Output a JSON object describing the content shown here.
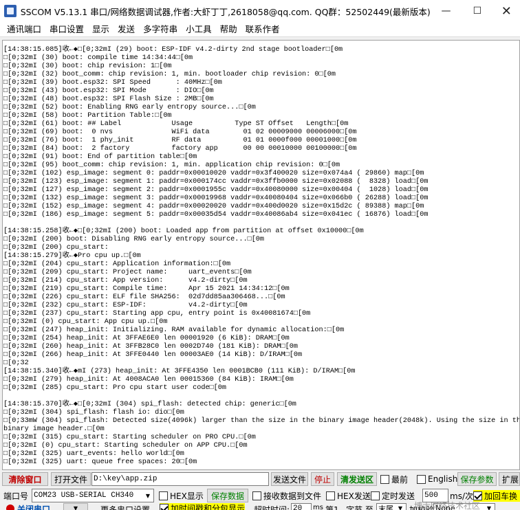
{
  "window": {
    "title": "SSCOM V5.13.1 串口/网络数据调试器,作者:大虾丁丁,2618058@qq.com. QQ群：52502449(最新版本)",
    "minimize": "—",
    "maximize": "☐",
    "close": "✕"
  },
  "menu": [
    "通讯端口",
    "串口设置",
    "显示",
    "发送",
    "多字符串",
    "小工具",
    "帮助",
    "联系作者"
  ],
  "console": {
    "lines": [
      "[14:38:15.085]收←◆□[0;32mI (29) boot: ESP-IDF v4.2-dirty 2nd stage bootloader□[0m",
      "□[0;32mI (30) boot: compile time 14:34:44□[0m",
      "□[0;32mI (30) boot: chip revision: 1□[0m",
      "□[0;32mI (32) boot_comm: chip revision: 1, min. bootloader chip revision: 0□[0m",
      "□[0;32mI (39) boot.esp32: SPI Speed      : 40MHz□[0m",
      "□[0;32mI (43) boot.esp32: SPI Mode       : DIO□[0m",
      "□[0;32mI (48) boot.esp32: SPI Flash Size : 2MB□[0m",
      "□[0;32mI (52) boot: Enabling RNG early entropy source...□[0m",
      "□[0;32mI (58) boot: Partition Table:□[0m",
      "□[0;32mI (61) boot: ## Label            Usage          Type ST Offset   Length□[0m",
      "□[0;32mI (69) boot:  0 nvs              WiFi data        01 02 00009000 00006000□[0m",
      "□[0;32mI (76) boot:  1 phy_init         RF data          01 01 0000f000 00001000□[0m",
      "□[0;32mI (84) boot:  2 factory          factory app      00 00 00010000 00100000□[0m",
      "□[0;32mI (91) boot: End of partition table□[0m",
      "□[0;32mI (95) boot_comm: chip revision: 1, min. application chip revision: 0□[0m",
      "□[0;32mI (102) esp_image: segment 0: paddr=0x00010020 vaddr=0x3f400020 size=0x074a4 ( 29860) map□[0m",
      "□[0;32mI (123) esp_image: segment 1: paddr=0x000174cc vaddr=0x3ffb0000 size=0x02088 (  8328) load□[0m",
      "□[0;32mI (127) esp_image: segment 2: paddr=0x0001955c vaddr=0x40080000 size=0x00404 (  1028) load□[0m",
      "□[0;32mI (132) esp_image: segment 3: paddr=0x00019968 vaddr=0x40080404 size=0x066b0 ( 26288) load□[0m",
      "□[0;32mI (152) esp_image: segment 4: paddr=0x00020020 vaddr=0x400d0020 size=0x15d2c ( 89388) map□[0m",
      "□[0;32mI (186) esp_image: segment 5: paddr=0x00035d54 vaddr=0x40086ab4 size=0x041ec ( 16876) load□[0m",
      "",
      "[14:38:15.258]收←◆□[0;32mI (200) boot: Loaded app from partition at offset 0x10000□[0m",
      "□[0;32mI (200) boot: Disabling RNG early entropy source...□[0m",
      "□[0;32mI (200) cpu_start:",
      "[14:38:15.279]收←◆Pro cpu up.□[0m",
      "□[0;32mI (204) cpu_start: Application information:□[0m",
      "□[0;32mI (209) cpu_start: Project name:     uart_events□[0m",
      "□[0;32mI (214) cpu_start: App version:      v4.2-dirty□[0m",
      "□[0;32mI (219) cpu_start: Compile time:     Apr 15 2021 14:34:12□[0m",
      "□[0;32mI (226) cpu_start: ELF file SHA256:  02d7dd85aa306468...□[0m",
      "□[0;32mI (232) cpu_start: ESP-IDF:          v4.2-dirty□[0m",
      "□[0;32mI (237) cpu_start: Starting app cpu, entry point is 0x40081674□[0m",
      "□[0;32mI (0) cpu_start: App cpu up.□[0m",
      "□[0;32mI (247) heap_init: Initializing. RAM available for dynamic allocation:□[0m",
      "□[0;32mI (254) heap_init: At 3FFAE6E0 len 00001920 (6 KiB): DRAM□[0m",
      "□[0;32mI (260) heap_init: At 3FFB28C0 len 0002D740 (181 KiB): DRAM□[0m",
      "□[0;32mI (266) heap_init: At 3FFE0440 len 00003AE0 (14 KiB): D/IRAM□[0m",
      "□[0;32",
      "[14:38:15.340]收←◆mI (273) heap_init: At 3FFE4350 len 0001BCB0 (111 KiB): D/IRAM□[0m",
      "□[0;32mI (279) heap_init: At 4008ACA0 len 00015360 (84 KiB): IRAM□[0m",
      "□[0;32mI (285) cpu_start: Pro cpu start user code□[0m",
      "",
      "[14:38:15.370]收←◆□[0;32mI (304) spi_flash: detected chip: generic□[0m",
      "□[0;32mI (304) spi_flash: flash io: dio□[0m",
      "□[0;33mW (304) spi_flash: Detected size(4096k) larger than the size in the binary image header(2048k). Using the size in the",
      "binary image header.□[0m",
      "□[0;32mI (315) cpu_start: Starting scheduler on PRO CPU.□[0m",
      "□[0;32mI (0) cpu_start: Starting scheduler on APP CPU.□[0m",
      "□[0;32mI (325) uart_events: hello world□[0m",
      "□[0;32mI (325) uart: queue free spaces: 20□[0m"
    ]
  },
  "row1": {
    "clear_window": "清除窗口",
    "open_file": "打开文件",
    "file_path": "D:\\key\\app.zip",
    "send_file": "发送文件",
    "stop": "停止",
    "clear_send": "清发送区",
    "topmost": "最前",
    "english": "English",
    "save_params": "保存参数",
    "expand": "扩展"
  },
  "row2": {
    "port_label": "端口号",
    "port_value": "COM23 USB-SERIAL CH340",
    "hex_display": "HEX显示",
    "save_data": "保存数据",
    "recv_to_file": "接收数据到文件",
    "hex_send": "HEX发送",
    "timed_send": "定时发送",
    "interval": "500",
    "interval_unit": "ms/次",
    "add_crlf": "加回车换"
  },
  "row3": {
    "close_port": "关闭串口",
    "more_settings": "更多串口设置",
    "timestamp_split": "加时间戳和分包显示",
    "timeout_label": "超时时间:",
    "timeout_value": "20",
    "timeout_unit": "ms",
    "byte_no": "第1",
    "byte_unit": "字节 至",
    "end_value": "末尾",
    "checksum_label": "加校验",
    "checksum_value": "None"
  },
  "watermark": "博士网络技术社区"
}
